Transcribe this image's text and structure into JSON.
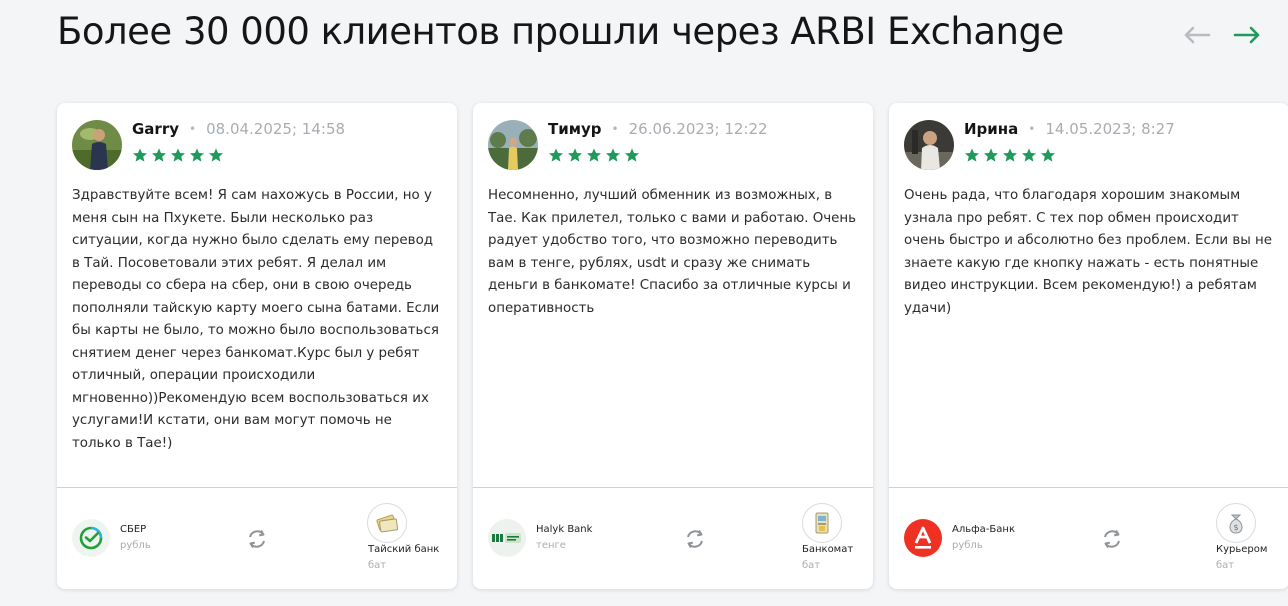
{
  "heading": "Более 30 000 клиентов прошли через ARBI Exchange",
  "nav": {
    "prev_icon": "arrow-left-icon",
    "next_icon": "arrow-right-icon"
  },
  "colors": {
    "accent": "#1f9a5a",
    "star": "#1f9a5a",
    "arrow_inactive": "#b8bcc1"
  },
  "reviews": [
    {
      "author": "Garry",
      "date": "08.04.2025; 14:58",
      "rating": 5,
      "text": "Здравствуйте всем! Я сам нахожусь в России, но у меня сын на Пхукете. Были несколько раз ситуации, когда нужно было сделать ему перевод в Тай. Посоветовали этих ребят. Я делал им переводы со сбера на сбер, они в свою очередь пополняли тайскую карту моего сына батами. Если бы карты не было, то можно было воспользоваться снятием денег через банкомат.Курс был у ребят отличный, операции происходили мгновенно))Рекомендую всем воспользоваться их услугами!И кстати, они вам могут помочь не только в Тае!)",
      "from": {
        "name": "СБЕР",
        "currency": "рубль",
        "icon": "sber-logo-icon"
      },
      "to": {
        "name": "Тайский банк",
        "currency": "бат",
        "icon": "thai-bank-card-icon"
      }
    },
    {
      "author": "Тимур",
      "date": "26.06.2023; 12:22",
      "rating": 5,
      "text": "Несомненно, лучший обменник из возможных, в Тае. Как прилетел, только с вами и работаю. Очень радует удобство того, что возможно переводить вам в тенге, рублях, usdt и сразу же снимать деньги в банкомате! Спасибо за отличные курсы и оперативность",
      "from": {
        "name": "Halyk Bank",
        "currency": "тенге",
        "icon": "halyk-bank-logo-icon"
      },
      "to": {
        "name": "Банкомат",
        "currency": "бат",
        "icon": "atm-icon"
      }
    },
    {
      "author": "Ирина",
      "date": "14.05.2023; 8:27",
      "rating": 5,
      "text": "Очень рада, что благодаря хорошим знакомым узнала про ребят. С тех пор обмен происходит очень быстро и абсолютно без проблем. Если вы не знаете какую где кнопку нажать - есть понятные видео инструкции. Всем рекомендую!) а ребятам удачи)",
      "from": {
        "name": "Альфа-Банк",
        "currency": "рубль",
        "icon": "alfa-bank-logo-icon"
      },
      "to": {
        "name": "Курьером",
        "currency": "бат",
        "icon": "courier-money-bag-icon"
      }
    }
  ]
}
